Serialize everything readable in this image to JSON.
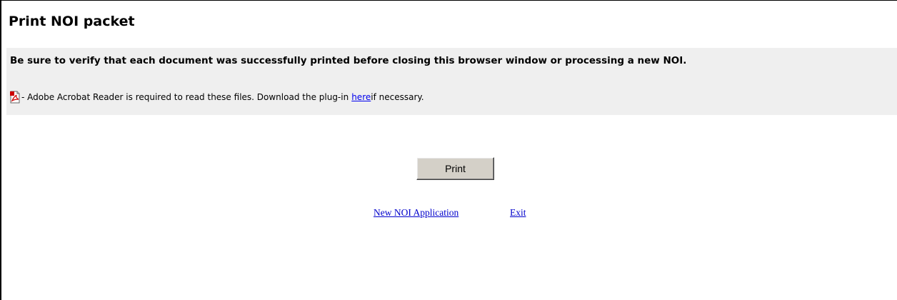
{
  "page": {
    "title": "Print NOI packet"
  },
  "notice": {
    "warning": "Be sure to verify that each document was successfully printed before closing this browser window or processing a new NOI.",
    "requirement_prefix": "- Adobe Acrobat Reader is required to read these files. Download the plug-in",
    "requirement_link": "here",
    "requirement_suffix": " if necessary.",
    "icon": "pdf-icon"
  },
  "actions": {
    "print_label": "Print"
  },
  "links": {
    "new_application": "New NOI Application",
    "exit": "Exit"
  },
  "colors": {
    "panel_background": "#efefef",
    "link": "#0000ee",
    "button_face": "#d4d0c8",
    "pdf_icon_red": "#cc0000"
  }
}
